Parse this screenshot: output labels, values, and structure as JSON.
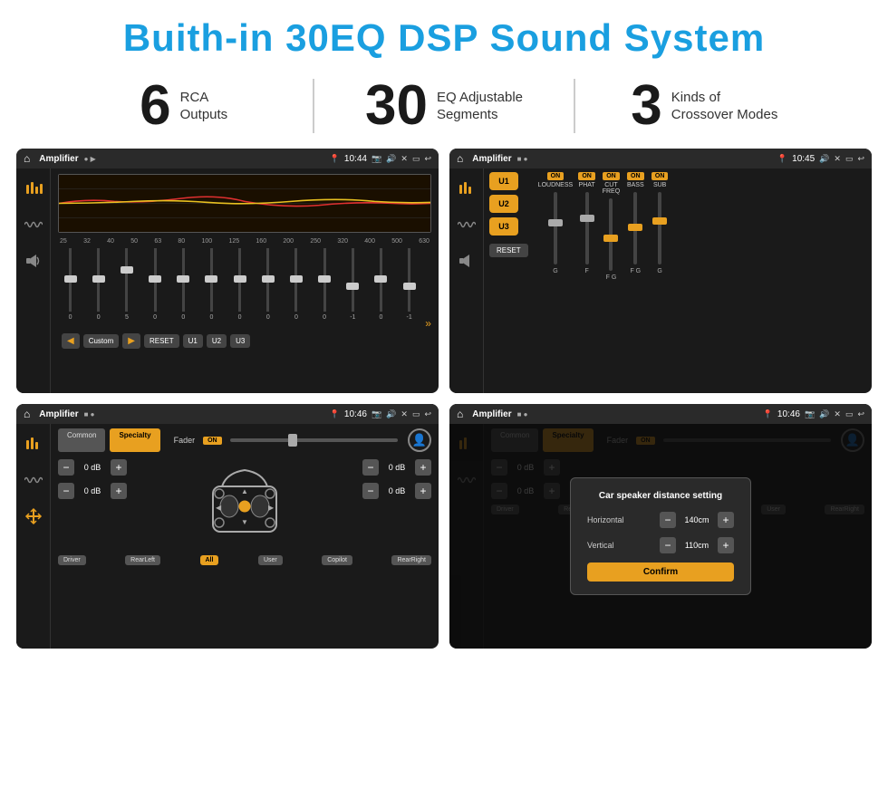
{
  "header": {
    "title": "Buith-in 30EQ DSP Sound System"
  },
  "stats": [
    {
      "number": "6",
      "label": "RCA\nOutputs"
    },
    {
      "number": "30",
      "label": "EQ Adjustable\nSegments"
    },
    {
      "number": "3",
      "label": "Kinds of\nCrossover Modes"
    }
  ],
  "screens": {
    "top_left": {
      "topbar_title": "Amplifier",
      "time": "10:44",
      "freq_labels": [
        "25",
        "32",
        "40",
        "50",
        "63",
        "80",
        "100",
        "125",
        "160",
        "200",
        "250",
        "320",
        "400",
        "500",
        "630"
      ],
      "slider_values": [
        "0",
        "0",
        "0",
        "5",
        "0",
        "0",
        "0",
        "0",
        "0",
        "0",
        "-1",
        "0",
        "-1"
      ],
      "buttons": [
        "Custom",
        "RESET",
        "U1",
        "U2",
        "U3"
      ]
    },
    "top_right": {
      "topbar_title": "Amplifier",
      "time": "10:45",
      "presets": [
        "U1",
        "U2",
        "U3"
      ],
      "controls": [
        {
          "label": "LOUDNESS",
          "on": true
        },
        {
          "label": "PHAT",
          "on": true
        },
        {
          "label": "CUT FREQ",
          "on": true
        },
        {
          "label": "BASS",
          "on": true
        },
        {
          "label": "SUB",
          "on": true
        }
      ],
      "reset_label": "RESET"
    },
    "bottom_left": {
      "topbar_title": "Amplifier",
      "time": "10:46",
      "tabs": [
        "Common",
        "Specialty"
      ],
      "active_tab": "Specialty",
      "fader_label": "Fader",
      "fader_on": true,
      "volumes": [
        "0 dB",
        "0 dB",
        "0 dB",
        "0 dB"
      ],
      "speaker_positions": [
        "Driver",
        "RearLeft",
        "All",
        "Copilot",
        "User",
        "RearRight"
      ]
    },
    "bottom_right": {
      "topbar_title": "Amplifier",
      "time": "10:46",
      "tabs": [
        "Common",
        "Specialty"
      ],
      "dialog": {
        "title": "Car speaker distance setting",
        "fields": [
          {
            "label": "Horizontal",
            "value": "140cm"
          },
          {
            "label": "Vertical",
            "value": "110cm"
          }
        ],
        "confirm_label": "Confirm"
      },
      "volumes": [
        "0 dB",
        "0 dB"
      ],
      "speaker_positions": [
        "Driver",
        "RearLeft",
        "All",
        "Copilot",
        "User",
        "RearRight"
      ]
    }
  }
}
